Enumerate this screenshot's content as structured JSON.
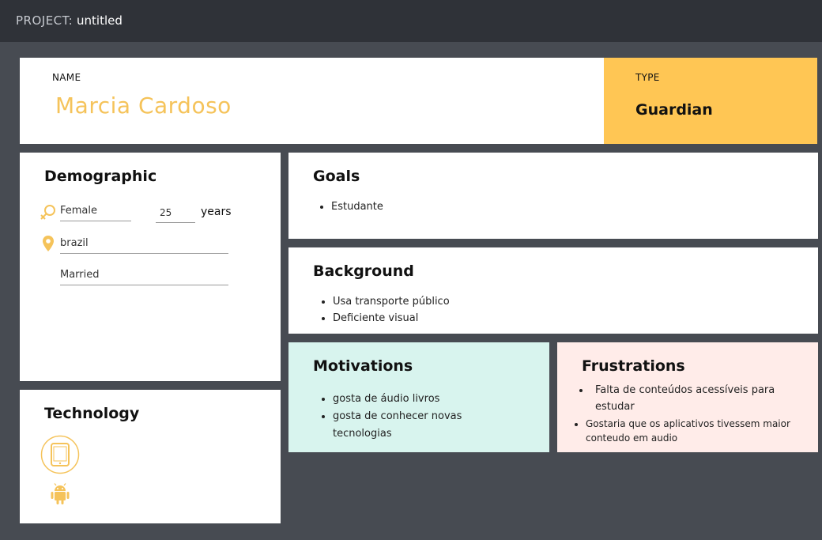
{
  "project": {
    "label": "PROJECT:",
    "name": "untitled"
  },
  "persona": {
    "name_label": "NAME",
    "name": "Marcia Cardoso",
    "type_label": "TYPE",
    "type": "Guardian"
  },
  "demographic": {
    "title": "Demographic",
    "gender": "Female",
    "age": "25",
    "age_unit": "years",
    "location": "brazil",
    "status": "Married"
  },
  "technology": {
    "title": "Technology",
    "icons": [
      "tablet-icon",
      "android-icon"
    ]
  },
  "goals": {
    "title": "Goals",
    "items": [
      "Estudante"
    ]
  },
  "background": {
    "title": "Background",
    "items": [
      "Usa transporte público",
      " Deficiente visual"
    ]
  },
  "motivations": {
    "title": "Motivations",
    "items": [
      "gosta de áudio livros",
      "gosta de conhecer novas tecnologias"
    ]
  },
  "frustrations": {
    "title": "Frustrations",
    "items": [
      "Falta de conteúdos acessíveis para estudar",
      "Gostaria que os aplicativos tivessem maior conteudo em audio"
    ]
  },
  "colors": {
    "accent": "#ffc654",
    "name": "#f5c35a",
    "motivations_bg": "#d8f4ee",
    "frustrations_bg": "#ffece9",
    "background": "#474b52",
    "topbar": "#2f3238"
  }
}
